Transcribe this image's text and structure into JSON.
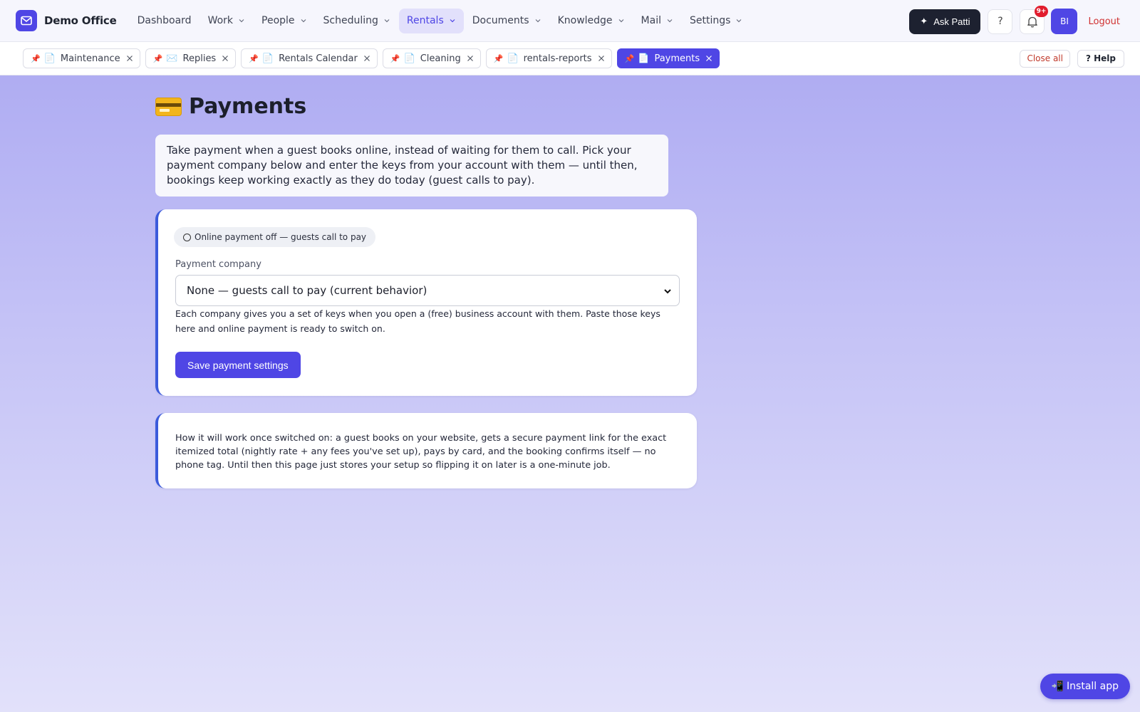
{
  "brand": {
    "name": "Demo Office",
    "icon": "mail-icon",
    "accent": "#4f46e5"
  },
  "nav": {
    "items": [
      {
        "label": "Dashboard",
        "dropdown": false,
        "active": false
      },
      {
        "label": "Work",
        "dropdown": true,
        "active": false
      },
      {
        "label": "People",
        "dropdown": true,
        "active": false
      },
      {
        "label": "Scheduling",
        "dropdown": true,
        "active": false
      },
      {
        "label": "Rentals",
        "dropdown": true,
        "active": true
      },
      {
        "label": "Documents",
        "dropdown": true,
        "active": false
      },
      {
        "label": "Knowledge",
        "dropdown": true,
        "active": false
      },
      {
        "label": "Mail",
        "dropdown": true,
        "active": false
      },
      {
        "label": "Settings",
        "dropdown": true,
        "active": false
      }
    ],
    "ask_label": "Ask Patti",
    "help_symbol": "?",
    "notif_badge": "9+",
    "avatar_initials": "BI",
    "logout_label": "Logout"
  },
  "tabs": {
    "items": [
      {
        "icon": "📄",
        "label": "Maintenance",
        "active": false
      },
      {
        "icon": "✉️",
        "label": "Replies",
        "active": false
      },
      {
        "icon": "📄",
        "label": "Rentals Calendar",
        "active": false
      },
      {
        "icon": "📄",
        "label": "Cleaning",
        "active": false
      },
      {
        "icon": "📄",
        "label": "rentals-reports",
        "active": false
      },
      {
        "icon": "📄",
        "label": "Payments",
        "active": true
      }
    ],
    "pin_symbol": "📌",
    "close_all_label": "Close all",
    "help_label": "? Help"
  },
  "main": {
    "title": "Payments",
    "title_icon": "credit-card-icon",
    "intro": "Take payment when a guest books online, instead of waiting for them to call. Pick your payment company below and enter the keys from your account with them — until then, bookings keep working exactly as they do today (guest calls to pay).",
    "status_label": "Online payment off — guests call to pay",
    "company_label": "Payment company",
    "company_selected": "None — guests call to pay (current behavior)",
    "hint": "Each company gives you a set of keys when you open a (free) business account with them. Paste those keys here and online payment is ready to switch on.",
    "save_label": "Save payment settings",
    "info": "How it will work once switched on: a guest books on your website, gets a secure payment link for the exact itemized total (nightly rate + any fees you've set up), pays by card, and the booking confirms itself — no phone tag. Until then this page just stores your setup so flipping it on later is a one-minute job."
  },
  "install": {
    "icon": "📲",
    "label": "Install app"
  }
}
